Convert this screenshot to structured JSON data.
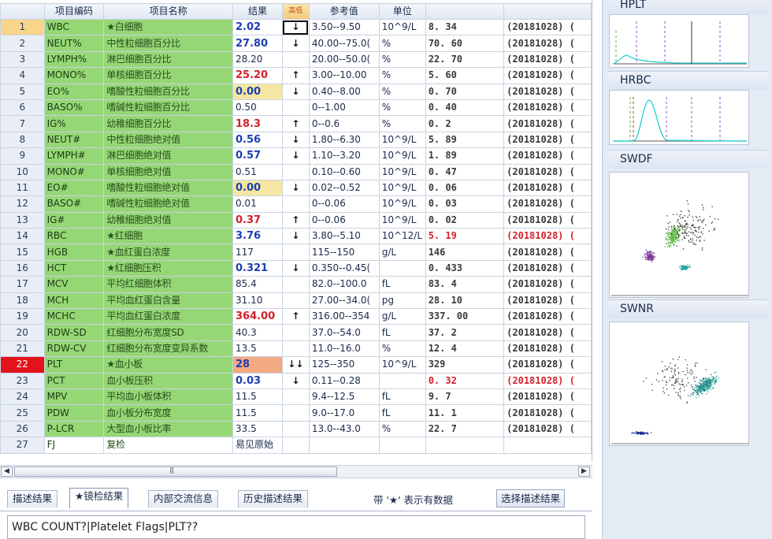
{
  "grid": {
    "columns": {
      "code": "项目编码",
      "name": "项目名称",
      "result": "结果",
      "flag": "高低",
      "reference": "参考值",
      "unit": "单位"
    },
    "rows": [
      {
        "num": "1",
        "code": "WBC",
        "name": "★白细胞",
        "result": "2.02",
        "flag": "↓",
        "ref": "3.50--9.50",
        "unit": "10^9/L",
        "value": "8. 34",
        "date": "(20181028) (",
        "style": "low",
        "rowstate": "sel",
        "boxed": true
      },
      {
        "num": "2",
        "code": "NEUT%",
        "name": "中性粒细胞百分比",
        "result": "27.80",
        "flag": "↓",
        "ref": "40.00--75.0(",
        "unit": "%",
        "value": "70. 60",
        "date": "(20181028) (",
        "style": "low"
      },
      {
        "num": "3",
        "code": "LYMPH%",
        "name": "淋巴细胞百分比",
        "result": "28.20",
        "flag": "",
        "ref": "20.00--50.0(",
        "unit": "%",
        "value": "22. 70",
        "date": "(20181028) (",
        "style": "normal"
      },
      {
        "num": "4",
        "code": "MONO%",
        "name": "单核细胞百分比",
        "result": "25.20",
        "flag": "↑",
        "ref": "3.00--10.00",
        "unit": "%",
        "value": "5. 60",
        "date": "(20181028) (",
        "style": "high"
      },
      {
        "num": "5",
        "code": "EO%",
        "name": "嗜酸性粒细胞百分比",
        "result": "0.00",
        "flag": "↓",
        "ref": "0.40--8.00",
        "unit": "%",
        "value": "0. 70",
        "date": "(20181028) (",
        "style": "low-yellow"
      },
      {
        "num": "6",
        "code": "BASO%",
        "name": "嗜碱性粒细胞百分比",
        "result": "0.50",
        "flag": "",
        "ref": "0--1.00",
        "unit": "%",
        "value": "0. 40",
        "date": "(20181028) (",
        "style": "normal"
      },
      {
        "num": "7",
        "code": "IG%",
        "name": "幼稚细胞百分比",
        "result": "18.3",
        "flag": "↑",
        "ref": "0--0.6",
        "unit": "%",
        "value": "0. 2",
        "date": "(20181028) (",
        "style": "high"
      },
      {
        "num": "8",
        "code": "NEUT#",
        "name": "中性粒细胞绝对值",
        "result": "0.56",
        "flag": "↓",
        "ref": "1.80--6.30",
        "unit": "10^9/L",
        "value": "5. 89",
        "date": "(20181028) (",
        "style": "low"
      },
      {
        "num": "9",
        "code": "LYMPH#",
        "name": "淋巴细胞绝对值",
        "result": "0.57",
        "flag": "↓",
        "ref": "1.10--3.20",
        "unit": "10^9/L",
        "value": "1. 89",
        "date": "(20181028) (",
        "style": "low"
      },
      {
        "num": "10",
        "code": "MONO#",
        "name": "单核细胞绝对值",
        "result": "0.51",
        "flag": "",
        "ref": "0.10--0.60",
        "unit": "10^9/L",
        "value": "0. 47",
        "date": "(20181028) (",
        "style": "normal"
      },
      {
        "num": "11",
        "code": "EO#",
        "name": "嗜酸性粒细胞绝对值",
        "result": "0.00",
        "flag": "↓",
        "ref": "0.02--0.52",
        "unit": "10^9/L",
        "value": "0. 06",
        "date": "(20181028) (",
        "style": "low-yellow"
      },
      {
        "num": "12",
        "code": "BASO#",
        "name": "嗜碱性粒细胞绝对值",
        "result": "0.01",
        "flag": "",
        "ref": "0--0.06",
        "unit": "10^9/L",
        "value": "0. 03",
        "date": "(20181028) (",
        "style": "normal"
      },
      {
        "num": "13",
        "code": "IG#",
        "name": "幼稚细胞绝对值",
        "result": "0.37",
        "flag": "↑",
        "ref": "0--0.06",
        "unit": "10^9/L",
        "value": "0. 02",
        "date": "(20181028) (",
        "style": "high"
      },
      {
        "num": "14",
        "code": "RBC",
        "name": "★红细胞",
        "result": "3.76",
        "flag": "↓",
        "ref": "3.80--5.10",
        "unit": "10^12/L",
        "value": "5. 19",
        "date": "(20181028) (",
        "style": "low",
        "red": true
      },
      {
        "num": "15",
        "code": "HGB",
        "name": "★血红蛋白浓度",
        "result": "117",
        "flag": "",
        "ref": "115--150",
        "unit": "g/L",
        "value": "146",
        "date": "(20181028) (",
        "style": "normal"
      },
      {
        "num": "16",
        "code": "HCT",
        "name": "★红细胞压积",
        "result": "0.321",
        "flag": "↓",
        "ref": "0.350--0.45(",
        "unit": "",
        "value": "0. 433",
        "date": "(20181028) (",
        "style": "low"
      },
      {
        "num": "17",
        "code": "MCV",
        "name": "平均红细胞体积",
        "result": "85.4",
        "flag": "",
        "ref": "82.0--100.0",
        "unit": "fL",
        "value": "83. 4",
        "date": "(20181028) (",
        "style": "normal"
      },
      {
        "num": "18",
        "code": "MCH",
        "name": "平均血红蛋白含量",
        "result": "31.10",
        "flag": "",
        "ref": "27.00--34.0(",
        "unit": "pg",
        "value": "28. 10",
        "date": "(20181028) (",
        "style": "normal"
      },
      {
        "num": "19",
        "code": "MCHC",
        "name": "平均血红蛋白浓度",
        "result": "364.00",
        "flag": "↑",
        "ref": "316.00--354",
        "unit": "g/L",
        "value": "337. 00",
        "date": "(20181028) (",
        "style": "high"
      },
      {
        "num": "20",
        "code": "RDW-SD",
        "name": "红细胞分布宽度SD",
        "result": "40.3",
        "flag": "",
        "ref": "37.0--54.0",
        "unit": "fL",
        "value": "37. 2",
        "date": "(20181028) (",
        "style": "normal"
      },
      {
        "num": "21",
        "code": "RDW-CV",
        "name": "红细胞分布宽度变异系数",
        "result": "13.5",
        "flag": "",
        "ref": "11.0--16.0",
        "unit": "%",
        "value": "12. 4",
        "date": "(20181028) (",
        "style": "normal"
      },
      {
        "num": "22",
        "code": "PLT",
        "name": "★血小板",
        "result": "28",
        "flag": "↓↓",
        "ref": "125--350",
        "unit": "10^9/L",
        "value": "329",
        "date": "(20181028) (",
        "style": "low-orange",
        "rowstate": "crit"
      },
      {
        "num": "23",
        "code": "PCT",
        "name": "血小板压积",
        "result": "0.03",
        "flag": "↓",
        "ref": "0.11--0.28",
        "unit": "",
        "value": "0. 32",
        "date": "(20181028) (",
        "style": "low",
        "red": true
      },
      {
        "num": "24",
        "code": "MPV",
        "name": "平均血小板体积",
        "result": "11.5",
        "flag": "",
        "ref": "9.4--12.5",
        "unit": "fL",
        "value": "9. 7",
        "date": "(20181028) (",
        "style": "normal"
      },
      {
        "num": "25",
        "code": "PDW",
        "name": "血小板分布宽度",
        "result": "11.5",
        "flag": "",
        "ref": "9.0--17.0",
        "unit": "fL",
        "value": "11. 1",
        "date": "(20181028) (",
        "style": "normal"
      },
      {
        "num": "26",
        "code": "P-LCR",
        "name": "大型血小板比率",
        "result": "33.5",
        "flag": "",
        "ref": "13.0--43.0",
        "unit": "%",
        "value": "22. 7",
        "date": "(20181028) (",
        "style": "normal"
      },
      {
        "num": "27",
        "code": "FJ",
        "name": "复检",
        "result": "易见原始",
        "flag": "",
        "ref": "",
        "unit": "",
        "value": "",
        "date": "",
        "style": "plain"
      }
    ]
  },
  "scrollbar": {
    "left_arrow": "◀",
    "right_arrow": "▶",
    "grip": "|||"
  },
  "tabs": [
    {
      "label": "描述结果",
      "active": false
    },
    {
      "label": "★镜检结果",
      "active": true
    },
    {
      "label": "内部交流信息",
      "active": false
    },
    {
      "label": "历史描述结果",
      "active": false
    }
  ],
  "legend_text": "带 '★' 表示有数据",
  "select_desc_button": "选择描述结果",
  "description_text": "WBC COUNT?|Platelet Flags|PLT??",
  "histograms": [
    {
      "title": "HPLT"
    },
    {
      "title": "HRBC"
    },
    {
      "title": "SWDF"
    },
    {
      "title": "SWNR"
    }
  ],
  "colors": {
    "green_cell": "#95d775",
    "low_text": "#1e3fb2",
    "high_text": "#d4202a",
    "critical_row": "#e3131b",
    "selected_row": "#f8d58a",
    "histogram_line": "#2fd3d0",
    "marker_green": "#3bbf45",
    "marker_purple": "#9a4fc7"
  }
}
